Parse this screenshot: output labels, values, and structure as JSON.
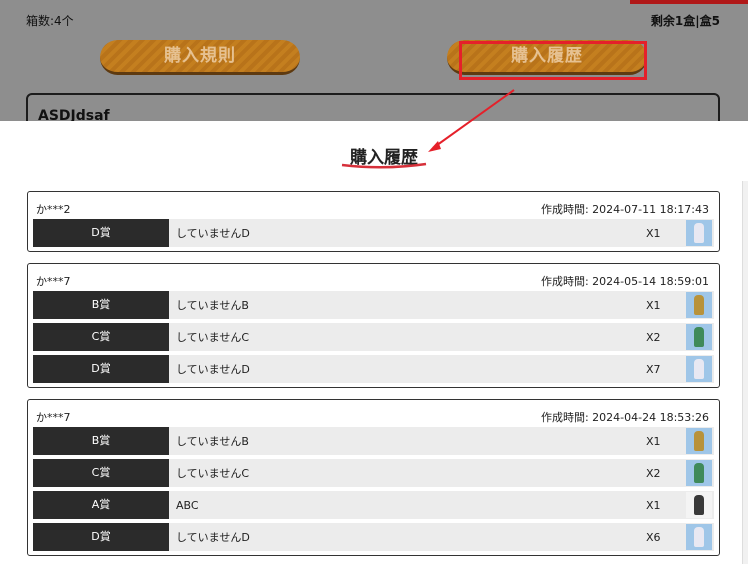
{
  "background": {
    "box_count": "箱数:4个",
    "remaining": "剩余1盒|盒5",
    "buttons": {
      "rules": "購入規則",
      "history": "購入履歴"
    },
    "panel_text": "ASDJdsaf"
  },
  "modal": {
    "title": "購入履歴",
    "orders": [
      {
        "user": "か***2",
        "time": "作成時間: 2024-07-11 18:17:43",
        "items": [
          {
            "grade": "D賞",
            "name": "していませんD",
            "qty": "X1",
            "thumb": "figure-blue"
          }
        ]
      },
      {
        "user": "か***7",
        "time": "作成時間: 2024-05-14 18:59:01",
        "items": [
          {
            "grade": "B賞",
            "name": "していませんB",
            "qty": "X1",
            "thumb": "figure-gold"
          },
          {
            "grade": "C賞",
            "name": "していませんC",
            "qty": "X2",
            "thumb": "figure-green"
          },
          {
            "grade": "D賞",
            "name": "していませんD",
            "qty": "X7",
            "thumb": "figure-blue"
          }
        ]
      },
      {
        "user": "か***7",
        "time": "作成時間: 2024-04-24 18:53:26",
        "items": [
          {
            "grade": "B賞",
            "name": "していませんB",
            "qty": "X1",
            "thumb": "figure-gold"
          },
          {
            "grade": "C賞",
            "name": "していませんC",
            "qty": "X2",
            "thumb": "figure-green"
          },
          {
            "grade": "A賞",
            "name": "ABC",
            "qty": "X1",
            "thumb": "figure-dark"
          },
          {
            "grade": "D賞",
            "name": "していませんD",
            "qty": "X6",
            "thumb": "figure-blue"
          }
        ]
      }
    ]
  },
  "colors": {
    "highlight": "#e5202a",
    "button_orange": "#c47f1f",
    "grade_bg": "#2b2b2b",
    "row_bg": "#ececec"
  }
}
